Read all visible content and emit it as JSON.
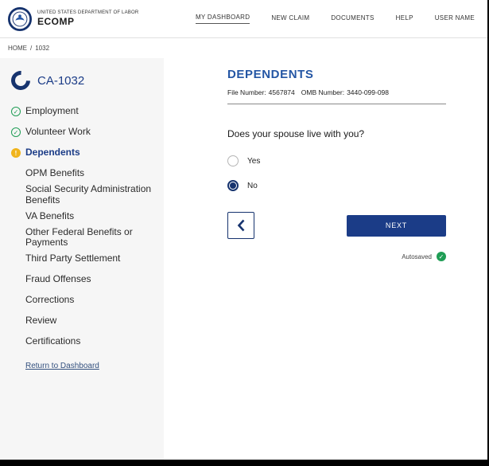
{
  "header": {
    "agency": "UNITED STATES DEPARTMENT OF LABOR",
    "app_name": "ECOMP",
    "nav": [
      {
        "label": "MY DASHBOARD",
        "active": true
      },
      {
        "label": "NEW CLAIM",
        "active": false
      },
      {
        "label": "DOCUMENTS",
        "active": false
      },
      {
        "label": "HELP",
        "active": false
      },
      {
        "label": "USER NAME",
        "active": false
      }
    ]
  },
  "breadcrumb": {
    "home": "HOME",
    "separator": "/",
    "current": "1032"
  },
  "sidebar": {
    "form_title": "CA-1032",
    "items": [
      {
        "label": "Employment",
        "status": "complete"
      },
      {
        "label": "Volunteer Work",
        "status": "complete"
      },
      {
        "label": "Dependents",
        "status": "current"
      },
      {
        "label": "OPM Benefits",
        "status": "pending"
      },
      {
        "label": "Social Security Administration Benefits",
        "status": "pending"
      },
      {
        "label": "VA Benefits",
        "status": "pending"
      },
      {
        "label": "Other Federal Benefits or Payments",
        "status": "pending"
      },
      {
        "label": "Third Party Settlement",
        "status": "pending"
      },
      {
        "label": "Fraud Offenses",
        "status": "pending"
      },
      {
        "label": "Corrections",
        "status": "pending"
      },
      {
        "label": "Review",
        "status": "pending"
      },
      {
        "label": "Certifications",
        "status": "pending"
      }
    ],
    "return_link": "Return to Dashboard"
  },
  "main": {
    "title": "DEPENDENTS",
    "file_number_label": "File Number:",
    "file_number_value": "4567874",
    "omb_number_label": "OMB Number:",
    "omb_number_value": "3440-099-098",
    "question": "Does your spouse live with you?",
    "options": [
      {
        "label": "Yes",
        "selected": false
      },
      {
        "label": "No",
        "selected": true
      }
    ],
    "next_button_label": "NEXT",
    "autosaved_label": "Autosaved"
  },
  "colors": {
    "navy": "#1b3c87",
    "heading_blue": "#2456a4",
    "green": "#1f9d55",
    "gold": "#f0b41c"
  }
}
